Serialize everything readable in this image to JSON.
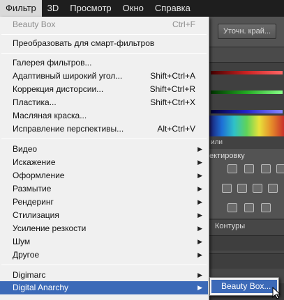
{
  "menubar": {
    "items": [
      "Фильтр",
      "3D",
      "Просмотр",
      "Окно",
      "Справка"
    ]
  },
  "app": {
    "refine_button": "Уточн. край...",
    "tabs_fragment": "или",
    "adjustments_fragment": "ектировку",
    "layers_tab": "Контуры"
  },
  "menu": {
    "last_filter": {
      "label": "Beauty Box",
      "shortcut": "Ctrl+F"
    },
    "smart": "Преобразовать для смарт-фильтров",
    "gallery": "Галерея фильтров...",
    "adaptive": {
      "label": "Адаптивный широкий угол...",
      "shortcut": "Shift+Ctrl+A"
    },
    "lens": {
      "label": "Коррекция дисторсии...",
      "shortcut": "Shift+Ctrl+R"
    },
    "liquify": {
      "label": "Пластика...",
      "shortcut": "Shift+Ctrl+X"
    },
    "oil": "Масляная краска...",
    "perspective": {
      "label": "Исправление перспективы...",
      "shortcut": "Alt+Ctrl+V"
    },
    "groups": [
      "Видео",
      "Искажение",
      "Оформление",
      "Размытие",
      "Рендеринг",
      "Стилизация",
      "Усиление резкости",
      "Шум",
      "Другое"
    ],
    "plugins": [
      "Digimarc",
      "Digital Anarchy"
    ]
  },
  "submenu": {
    "item": "Beauty Box..."
  },
  "colors": {
    "highlight": "#3c6ab8",
    "menu_bg": "#f0f0f0",
    "menubar_bg": "#1e1e1e"
  }
}
